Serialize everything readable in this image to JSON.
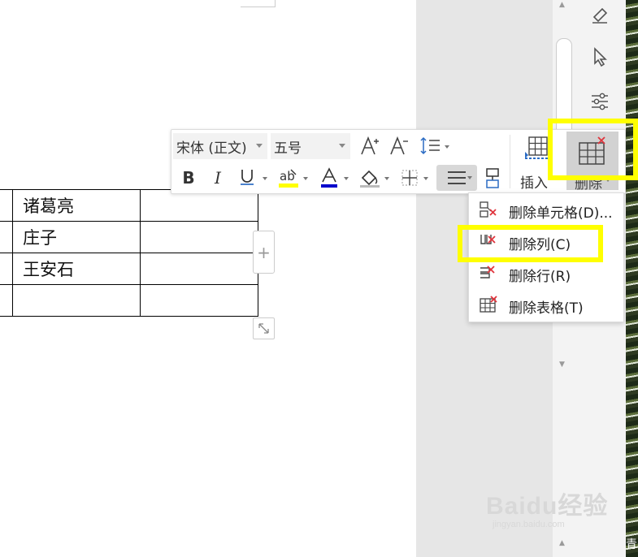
{
  "table": {
    "rows": [
      {
        "name": "诸葛亮"
      },
      {
        "name": "庄子"
      },
      {
        "name": "王安石"
      },
      {
        "name": ""
      }
    ]
  },
  "toolbar": {
    "font_family": "宋体 (正文)",
    "font_size": "五号",
    "insert_label": "插入",
    "delete_label": "删除",
    "highlight_color": "#ffff00",
    "font_color": "#0000cc"
  },
  "context_menu": {
    "items": [
      {
        "label": "删除单元格(D)...",
        "icon": "delete-cell-icon"
      },
      {
        "label": "删除列(C)",
        "icon": "delete-column-icon"
      },
      {
        "label": "删除行(R)",
        "icon": "delete-row-icon"
      },
      {
        "label": "删除表格(T)",
        "icon": "delete-table-icon"
      }
    ]
  },
  "annotation": {
    "color": "#ffff00"
  },
  "watermark": {
    "brand": "Baidu经验",
    "url": "jingyan.baidu.com"
  },
  "edge_text": "青"
}
